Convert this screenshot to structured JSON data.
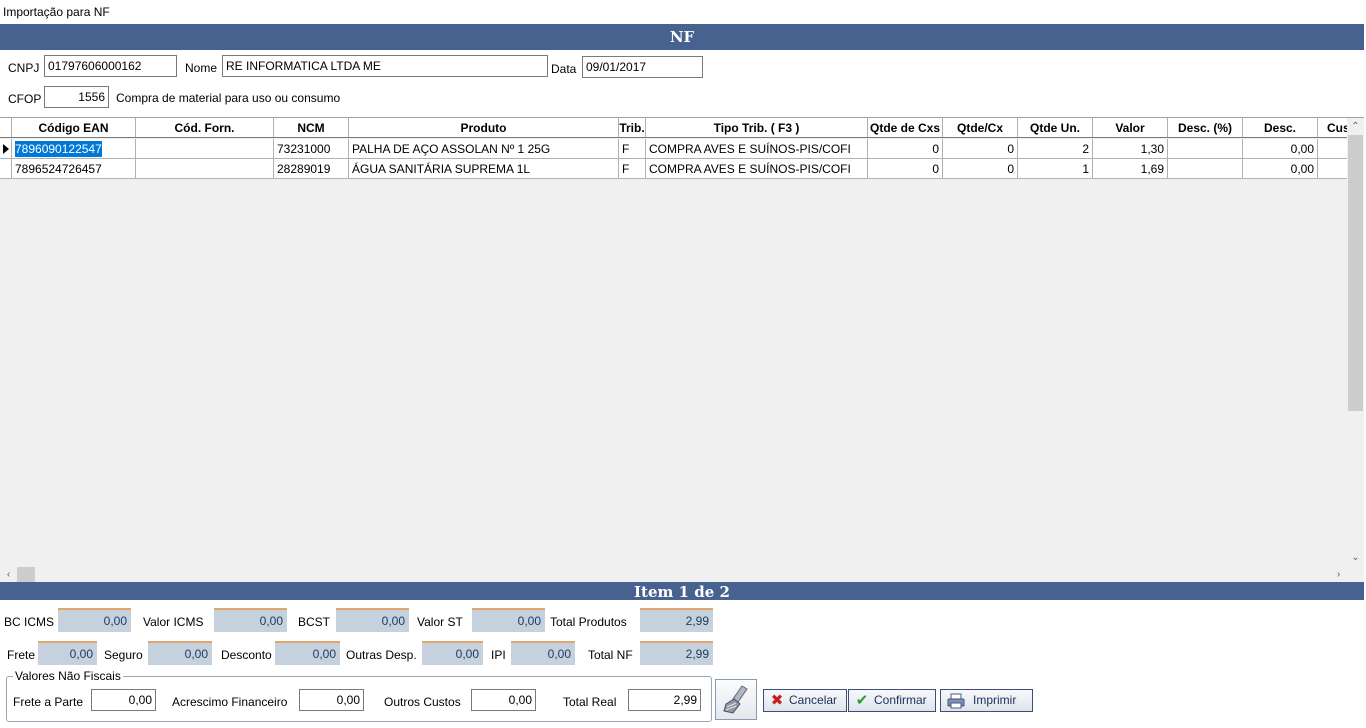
{
  "window": {
    "title": "Importação para NF"
  },
  "header": {
    "band_title": "NF"
  },
  "form": {
    "cnpj_label": "CNPJ",
    "cnpj_value": "01797606000162",
    "nome_label": "Nome",
    "nome_value": "RE INFORMATICA LTDA ME",
    "data_label": "Data",
    "data_value": "09/01/2017",
    "cfop_label": "CFOP",
    "cfop_value": "1556",
    "cfop_desc": "Compra de material para uso ou consumo"
  },
  "grid": {
    "columns": [
      "Código EAN",
      "Cód. Forn.",
      "NCM",
      "Produto",
      "Trib.",
      "Tipo Trib. ( F3 )",
      "Qtde de Cxs",
      "Qtde/Cx",
      "Qtde Un.",
      "Valor",
      "Desc. (%)",
      "Desc.",
      "Cus"
    ],
    "rows": [
      [
        "7896090122547",
        "",
        "73231000",
        "PALHA DE AÇO ASSOLAN Nº 1 25G",
        "F",
        "COMPRA AVES E SUÍNOS-PIS/COFI",
        "0",
        "0",
        "2",
        "1,30",
        "",
        "0,00",
        ""
      ],
      [
        "7896524726457",
        "",
        "28289019",
        "ÁGUA SANITÁRIA SUPREMA 1L",
        "F",
        "COMPRA AVES E SUÍNOS-PIS/COFI",
        "0",
        "0",
        "1",
        "1,69",
        "",
        "0,00",
        ""
      ]
    ]
  },
  "item_band": {
    "title": "Item 1 de 2"
  },
  "totals": {
    "bc_icms_label": "BC ICMS",
    "bc_icms": "0,00",
    "valor_icms_label": "Valor ICMS",
    "valor_icms": "0,00",
    "bcst_label": "BCST",
    "bcst": "0,00",
    "valor_st_label": "Valor ST",
    "valor_st": "0,00",
    "total_produtos_label": "Total Produtos",
    "total_produtos": "2,99",
    "frete_label": "Frete",
    "frete": "0,00",
    "seguro_label": "Seguro",
    "seguro": "0,00",
    "desconto_label": "Desconto",
    "desconto": "0,00",
    "outras_desp_label": "Outras Desp.",
    "outras_desp": "0,00",
    "ipi_label": "IPI",
    "ipi": "0,00",
    "total_nf_label": "Total NF",
    "total_nf": "2,99"
  },
  "nao_fiscais": {
    "group_title": "Valores Não Fiscais",
    "frete_parte_label": "Frete a Parte",
    "frete_parte": "0,00",
    "acrescimo_label": "Acrescimo Financeiro",
    "acrescimo": "0,00",
    "outros_custos_label": "Outros Custos",
    "outros_custos": "0,00",
    "total_real_label": "Total Real",
    "total_real": "2,99"
  },
  "buttons": {
    "cancelar": "Cancelar",
    "confirmar": "Confirmar",
    "imprimir": "Imprimir"
  },
  "colors": {
    "band": "#47628f",
    "selection": "#0078d7",
    "readonly_bg": "#c5d1dc",
    "readonly_accent": "#e2a56c"
  }
}
